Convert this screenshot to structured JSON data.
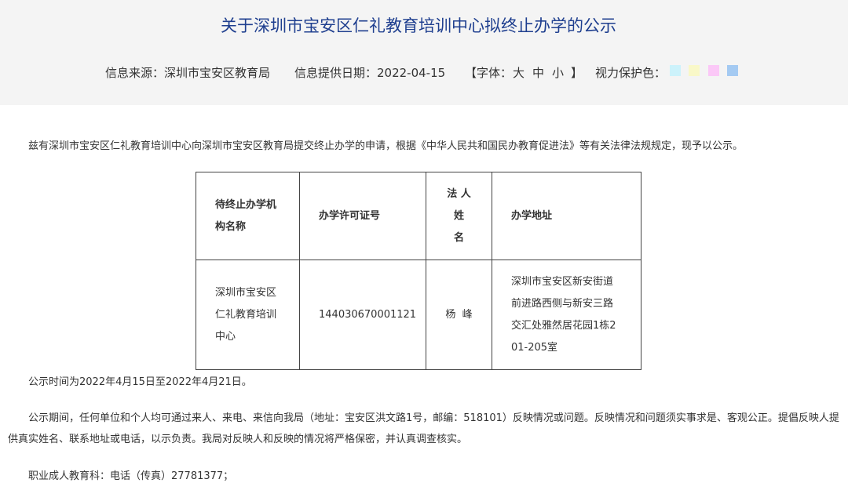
{
  "header": {
    "title": "关于深圳市宝安区仁礼教育培训中心拟终止办学的公示",
    "source_label": "信息来源：深圳市宝安区教育局",
    "date_label": "信息提供日期：2022-04-15",
    "font_open": "【字体：",
    "font_large": "大",
    "font_medium": "中",
    "font_small": "小",
    "font_close": "】",
    "eye_label": "视力保护色：",
    "swatch_colors": [
      "#ccf2fb",
      "#f9f8c8",
      "#fbc8f7",
      "#a4caf2"
    ]
  },
  "intro": "兹有深圳市宝安区仁礼教育培训中心向深圳市宝安区教育局提交终止办学的申请，根据《中华人民共和国民办教育促进法》等有关法律法规规定，现予以公示。",
  "table": {
    "headers": {
      "org_line1": "待终止办学机",
      "org_line2": "构名称",
      "license": "办学许可证号",
      "person_line1": "法 人",
      "person_line2": "姓",
      "person_line3": "名",
      "address": "办学地址"
    },
    "row": {
      "org_line1": "深圳市宝安区",
      "org_line2": "仁礼教育培训",
      "org_line3": "中心",
      "license": "144030670001121",
      "person": "杨  峰",
      "addr_line1": "深圳市宝安区新安街道",
      "addr_line2": "前进路西侧与新安三路",
      "addr_line3": "交汇处雅然居花园1栋2",
      "addr_line4": "01-205室"
    }
  },
  "period": "公示时间为2022年4月15日至2022年4月21日。",
  "feedback": "公示期间，任何单位和个人均可通过来人、来电、来信向我局（地址：宝安区洪文路1号，邮编：518101）反映情况或问题。反映情况和问题须实事求是、客观公正。提倡反映人提供真实姓名、联系地址或电话，以示负责。我局对反映人和反映的情况将严格保密，并认真调查核实。",
  "contact": "职业成人教育科：电话（传真）27781377；"
}
